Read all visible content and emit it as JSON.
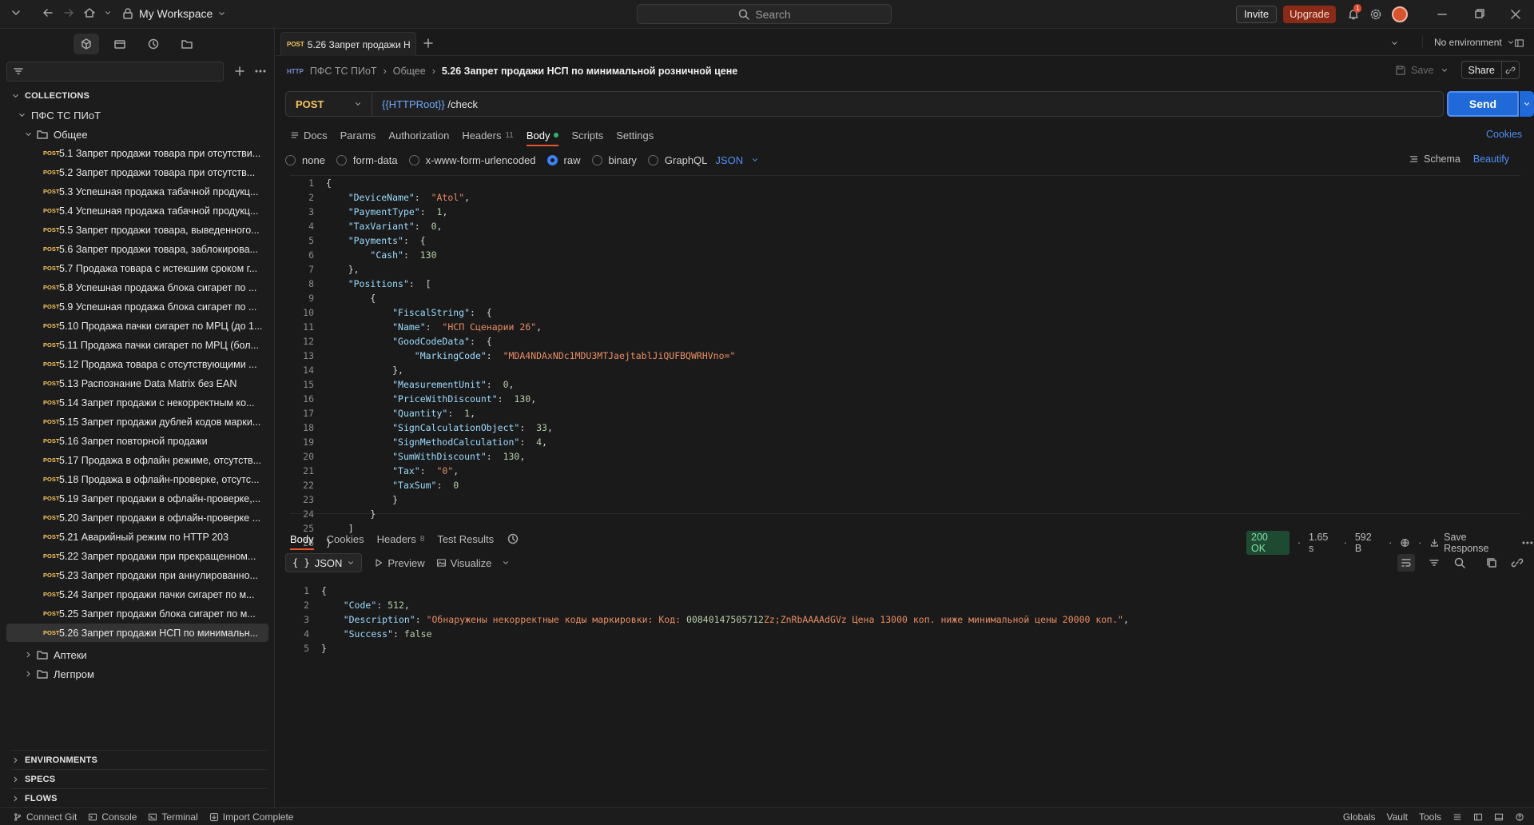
{
  "topbar": {
    "workspace": "My Workspace",
    "search_placeholder": "Search",
    "invite": "Invite",
    "upgrade": "Upgrade",
    "notif_count": "1"
  },
  "sidebar": {
    "collections_label": "COLLECTIONS",
    "collection_name": "ПФС ТС ПИоТ",
    "folder_open": "Общее",
    "requests": [
      {
        "method": "POST",
        "title": "5.1 Запрет продажи товара при отсутстви..."
      },
      {
        "method": "POST",
        "title": "5.2 Запрет продажи товара при отсутств..."
      },
      {
        "method": "POST",
        "title": "5.3 Успешная продажа табачной продукц..."
      },
      {
        "method": "POST",
        "title": "5.4 Успешная продажа табачной продукц..."
      },
      {
        "method": "POST",
        "title": "5.5 Запрет продажи товара, выведенного..."
      },
      {
        "method": "POST",
        "title": "5.6 Запрет продажи товара, заблокирова..."
      },
      {
        "method": "POST",
        "title": "5.7 Продажа товара с истекшим сроком г..."
      },
      {
        "method": "POST",
        "title": "5.8 Успешная продажа блока сигарет по ..."
      },
      {
        "method": "POST",
        "title": "5.9 Успешная продажа блока сигарет по ..."
      },
      {
        "method": "POST",
        "title": "5.10 Продажа пачки сигарет по МРЦ (до 1..."
      },
      {
        "method": "POST",
        "title": "5.11 Продажа пачки сигарет по МРЦ (бол..."
      },
      {
        "method": "POST",
        "title": "5.12 Продажа товара с отсутствующими ..."
      },
      {
        "method": "POST",
        "title": "5.13 Распознание Data Matrix без EAN"
      },
      {
        "method": "POST",
        "title": "5.14 Запрет продажи с некорректным ко..."
      },
      {
        "method": "POST",
        "title": "5.15 Запрет продажи дублей кодов марки..."
      },
      {
        "method": "POST",
        "title": "5.16 Запрет повторной продажи"
      },
      {
        "method": "POST",
        "title": "5.17 Продажа в офлайн режиме, отсутств..."
      },
      {
        "method": "POST",
        "title": "5.18 Продажа в офлайн-проверке, отсутс..."
      },
      {
        "method": "POST",
        "title": "5.19 Запрет продажи в офлайн-проверке,..."
      },
      {
        "method": "POST",
        "title": "5.20 Запрет продажи в офлайн-проверке ..."
      },
      {
        "method": "POST",
        "title": "5.21 Аварийный режим по HTTP 203"
      },
      {
        "method": "POST",
        "title": "5.22 Запрет продажи при прекращенном..."
      },
      {
        "method": "POST",
        "title": "5.23 Запрет продажи при аннулированно..."
      },
      {
        "method": "POST",
        "title": "5.24 Запрет продажи пачки сигарет по м..."
      },
      {
        "method": "POST",
        "title": "5.25 Запрет продажи блока сигарет по м..."
      },
      {
        "method": "POST",
        "title": "5.26 Запрет продажи НСП по минимальн..."
      }
    ],
    "folders_closed": [
      "Аптеки",
      "Легпром"
    ],
    "bottom_sections": [
      "ENVIRONMENTS",
      "SPECS",
      "FLOWS"
    ]
  },
  "main": {
    "tab": {
      "method": "POST",
      "title": "5.26 Запрет продажи Н"
    },
    "environment": "No environment",
    "breadcrumb": {
      "http": "HTTP",
      "collection": "ПФС ТС ПИоТ",
      "folder": "Общее",
      "current": "5.26 Запрет продажи НСП по минимальной розничной цене"
    },
    "save": "Save",
    "share": "Share",
    "method": "POST",
    "url_var": "{{HTTPRoot}}",
    "url_path": " /check",
    "send": "Send",
    "req_tabs": [
      {
        "label": "Docs"
      },
      {
        "label": "Params"
      },
      {
        "label": "Authorization"
      },
      {
        "label": "Headers",
        "count": "11"
      },
      {
        "label": "Body"
      },
      {
        "label": "Scripts"
      },
      {
        "label": "Settings"
      }
    ],
    "cookies": "Cookies",
    "body_types": [
      "none",
      "form-data",
      "x-www-form-urlencoded",
      "raw",
      "binary",
      "GraphQL"
    ],
    "body_format": "JSON",
    "schema": "Schema",
    "beautify": "Beautify",
    "request_lines": [
      "{",
      "    \"DeviceName\":  \"Atol\",",
      "    \"PaymentType\":  1,",
      "    \"TaxVariant\":  0,",
      "    \"Payments\":  {",
      "        \"Cash\":  130",
      "    },",
      "    \"Positions\":  [",
      "        {",
      "            \"FiscalString\":  {",
      "            \"Name\":  \"НСП Сценарии 26\",",
      "            \"GoodCodeData\":  {",
      "                \"MarkingCode\":  \"MDA4NDAxNDc1MDU3MTJaejtablJiQUFBQWRHVno=\"",
      "            },",
      "            \"MeasurementUnit\":  0,",
      "            \"PriceWithDiscount\":  130,",
      "            \"Quantity\":  1,",
      "            \"SignCalculationObject\":  33,",
      "            \"SignMethodCalculation\":  4,",
      "            \"SumWithDiscount\":  130,",
      "            \"Tax\":  \"0\",",
      "            \"TaxSum\":  0",
      "            }",
      "        }",
      "    ]",
      "}"
    ],
    "resp_tabs": [
      {
        "label": "Body"
      },
      {
        "label": "Cookies"
      },
      {
        "label": "Headers",
        "count": "8"
      },
      {
        "label": "Test Results"
      }
    ],
    "status": "200 OK",
    "time": "1.65 s",
    "size": "592 B",
    "save_response": "Save Response",
    "resp_format": "JSON",
    "preview": "Preview",
    "visualize": "Visualize",
    "response_lines": [
      "{",
      "    \"Code\": 512,",
      "    \"Description\": \"Обнаружены некорректные коды маркировки: Код: 00840147505712Zz;ZnRbAAAAdGVz Цена 13000 коп. ниже минимальной цены 20000 коп.\",",
      "    \"Success\": false",
      "}"
    ]
  },
  "statusbar": {
    "connect_git": "Connect Git",
    "console": "Console",
    "terminal": "Terminal",
    "import": "Import Complete",
    "globals": "Globals",
    "vault": "Vault",
    "tools": "Tools"
  }
}
